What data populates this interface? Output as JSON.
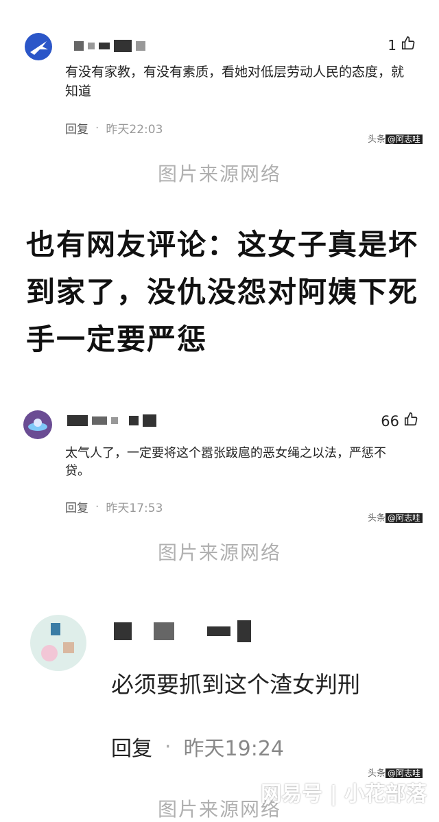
{
  "comments": [
    {
      "likes": "1",
      "text": "有没有家教，有没有素质，看她对低层劳动人民的态度，就知道",
      "reply_label": "回复",
      "separator": "·",
      "time": "昨天22:03",
      "watermark_prefix": "头条",
      "watermark_handle": "@阿志哇"
    },
    {
      "likes": "66",
      "text": "太气人了，一定要将这个嚣张跋扈的恶女绳之以法，严惩不贷。",
      "reply_label": "回复",
      "separator": "·",
      "time": "昨天17:53",
      "watermark_prefix": "头条",
      "watermark_handle": "@阿志哇"
    },
    {
      "text": "必须要抓到这个渣女判刑",
      "reply_label": "回复",
      "separator": "·",
      "time": "昨天19:24",
      "watermark_prefix": "头条",
      "watermark_handle": "@阿志哇"
    }
  ],
  "image_source_label": "图片来源网络",
  "article_text": "也有网友评论：这女子真是坏到家了，没仇没怨对阿姨下死手一定要严惩",
  "brand": "网易号 | 小花部落",
  "icons": {
    "like": "thumbs-up-icon"
  }
}
